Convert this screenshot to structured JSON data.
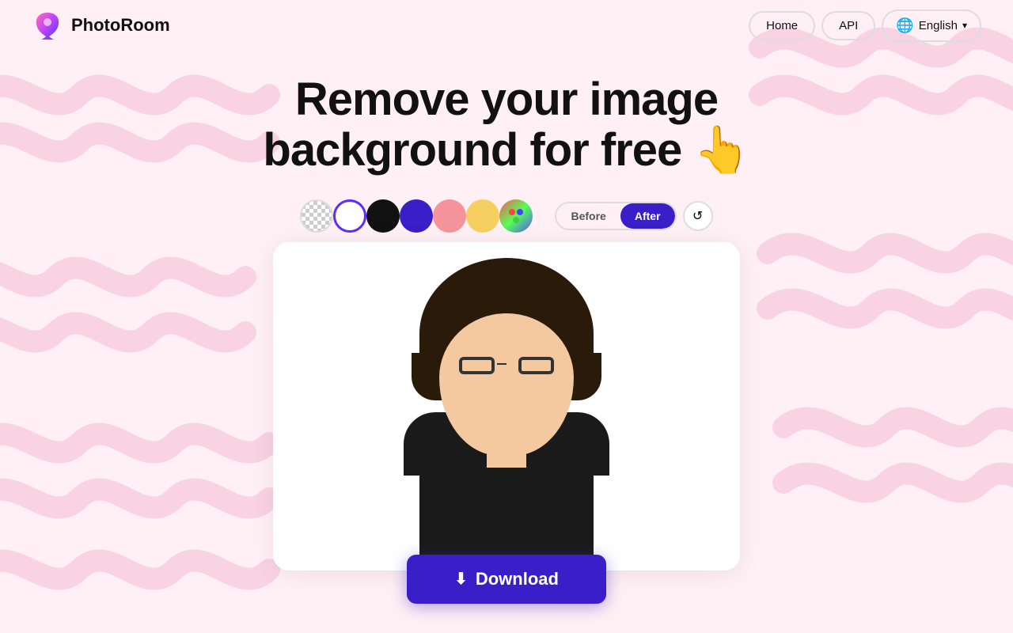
{
  "brand": {
    "logo_text": "PhotoRoom",
    "logo_icon": "P"
  },
  "navbar": {
    "home_label": "Home",
    "api_label": "API",
    "language_label": "English",
    "language_icon": "🌐"
  },
  "headline": {
    "line1": "Remove your image",
    "line2": "background for free",
    "emoji": "👆"
  },
  "color_swatches": [
    {
      "id": "transparent",
      "label": "Transparent",
      "type": "transparent"
    },
    {
      "id": "white",
      "label": "White",
      "type": "white",
      "active": true
    },
    {
      "id": "black",
      "label": "Black",
      "type": "black"
    },
    {
      "id": "purple",
      "label": "Purple",
      "type": "purple"
    },
    {
      "id": "pink",
      "label": "Pink",
      "type": "pink"
    },
    {
      "id": "yellow",
      "label": "Yellow",
      "type": "yellow"
    },
    {
      "id": "more",
      "label": "More colors",
      "type": "dots"
    }
  ],
  "toggle": {
    "before_label": "Before",
    "after_label": "After",
    "active": "after"
  },
  "reset_icon": "↺",
  "download_button": {
    "label": "Download",
    "icon": "⬇"
  },
  "colors": {
    "brand_purple": "#3a1ec7",
    "white": "#ffffff",
    "black": "#111111",
    "purple_swatch": "#3a1ec7",
    "pink_swatch": "#f5939a",
    "yellow_swatch": "#f5d060"
  }
}
